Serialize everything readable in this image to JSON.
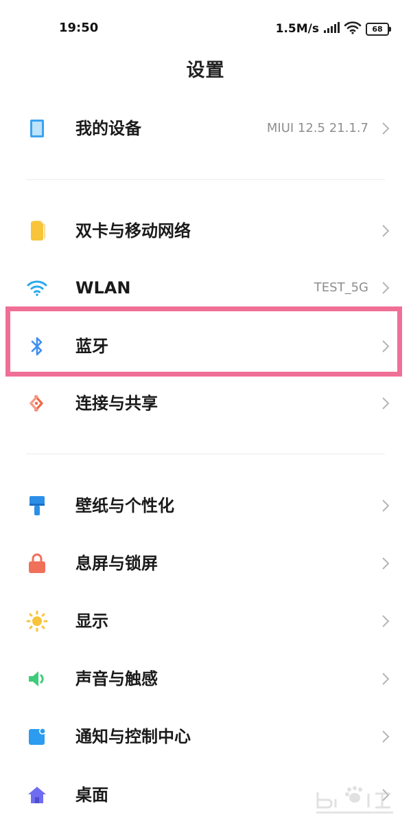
{
  "status": {
    "time": "19:50",
    "net_speed": "1.5M/s",
    "battery": "68"
  },
  "page": {
    "title": "设置"
  },
  "rows": [
    {
      "label": "我的设备",
      "value": "MIUI 12.5 21.1.7",
      "icon": "tablet-icon",
      "color": "#3aa3f0"
    },
    {
      "label": "双卡与移动网络",
      "value": "",
      "icon": "sim-card-icon",
      "color": "#f7c43a"
    },
    {
      "label": "WLAN",
      "value": "TEST_5G",
      "icon": "wifi-icon",
      "color": "#2aa9f0"
    },
    {
      "label": "蓝牙",
      "value": "",
      "icon": "bluetooth-icon",
      "color": "#3d8ff0"
    },
    {
      "label": "连接与共享",
      "value": "",
      "icon": "connection-share-icon",
      "color": "#f06a4a"
    },
    {
      "label": "壁纸与个性化",
      "value": "",
      "icon": "paint-brush-icon",
      "color": "#2b8fe8"
    },
    {
      "label": "息屏与锁屏",
      "value": "",
      "icon": "lock-icon",
      "color": "#f0705a"
    },
    {
      "label": "显示",
      "value": "",
      "icon": "sun-icon",
      "color": "#f7c43a"
    },
    {
      "label": "声音与触感",
      "value": "",
      "icon": "speaker-icon",
      "color": "#3dcc7a"
    },
    {
      "label": "通知与控制中心",
      "value": "",
      "icon": "notification-icon",
      "color": "#2b9cf0"
    },
    {
      "label": "桌面",
      "value": "",
      "icon": "home-icon",
      "color": "#6e6cf0"
    }
  ]
}
